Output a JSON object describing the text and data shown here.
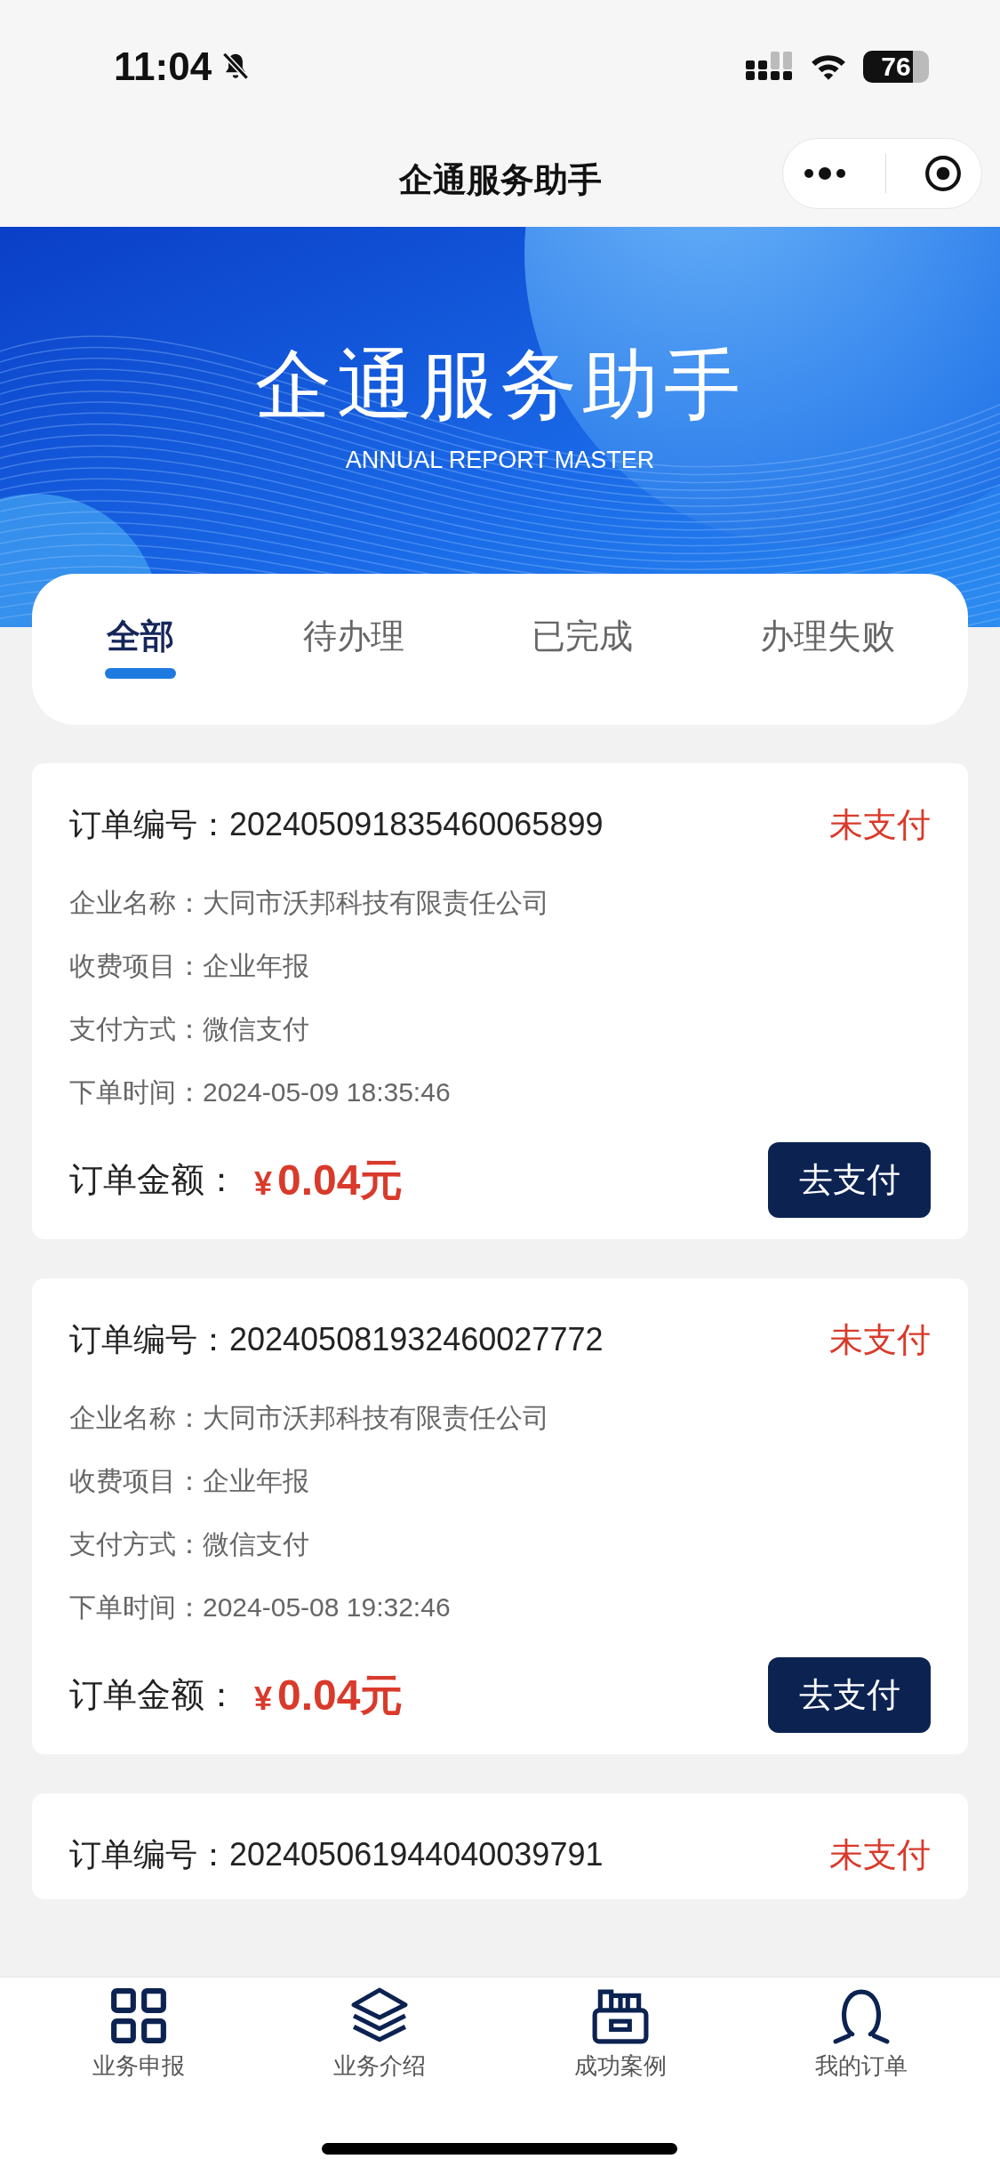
{
  "status_bar": {
    "time": "11:04",
    "battery": "76"
  },
  "nav_bar": {
    "title": "企通服务助手"
  },
  "banner": {
    "title": "企通服务助手",
    "subtitle": "ANNUAL REPORT MASTER"
  },
  "tabs": [
    {
      "label": "全部",
      "selected": true
    },
    {
      "label": "待办理",
      "selected": false
    },
    {
      "label": "已完成",
      "selected": false
    },
    {
      "label": "办理失败",
      "selected": false
    }
  ],
  "orders": [
    {
      "number_label": "订单编号：",
      "number": "202405091835460065899",
      "status": "未支付",
      "fields": [
        {
          "label": "企业名称：",
          "value": "大同市沃邦科技有限责任公司"
        },
        {
          "label": "收费项目：",
          "value": "企业年报"
        },
        {
          "label": "支付方式：",
          "value": "微信支付"
        },
        {
          "label": "下单时间：",
          "value": "2024-05-09 18:35:46"
        }
      ],
      "amount_label": "订单金额：",
      "currency": "¥",
      "amount": "0.04元",
      "button": "去支付"
    },
    {
      "number_label": "订单编号：",
      "number": "202405081932460027772",
      "status": "未支付",
      "fields": [
        {
          "label": "企业名称：",
          "value": "大同市沃邦科技有限责任公司"
        },
        {
          "label": "收费项目：",
          "value": "企业年报"
        },
        {
          "label": "支付方式：",
          "value": "微信支付"
        },
        {
          "label": "下单时间：",
          "value": "2024-05-08 19:32:46"
        }
      ],
      "amount_label": "订单金额：",
      "currency": "¥",
      "amount": "0.04元",
      "button": "去支付"
    },
    {
      "number_label": "订单编号：",
      "number": "202405061944040039791",
      "status": "未支付"
    }
  ],
  "tab_bar": [
    {
      "kind": "grid",
      "label": "业务申报"
    },
    {
      "kind": "layers",
      "label": "业务介绍"
    },
    {
      "kind": "register",
      "label": "成功案例"
    },
    {
      "kind": "user",
      "label": "我的订单"
    }
  ]
}
